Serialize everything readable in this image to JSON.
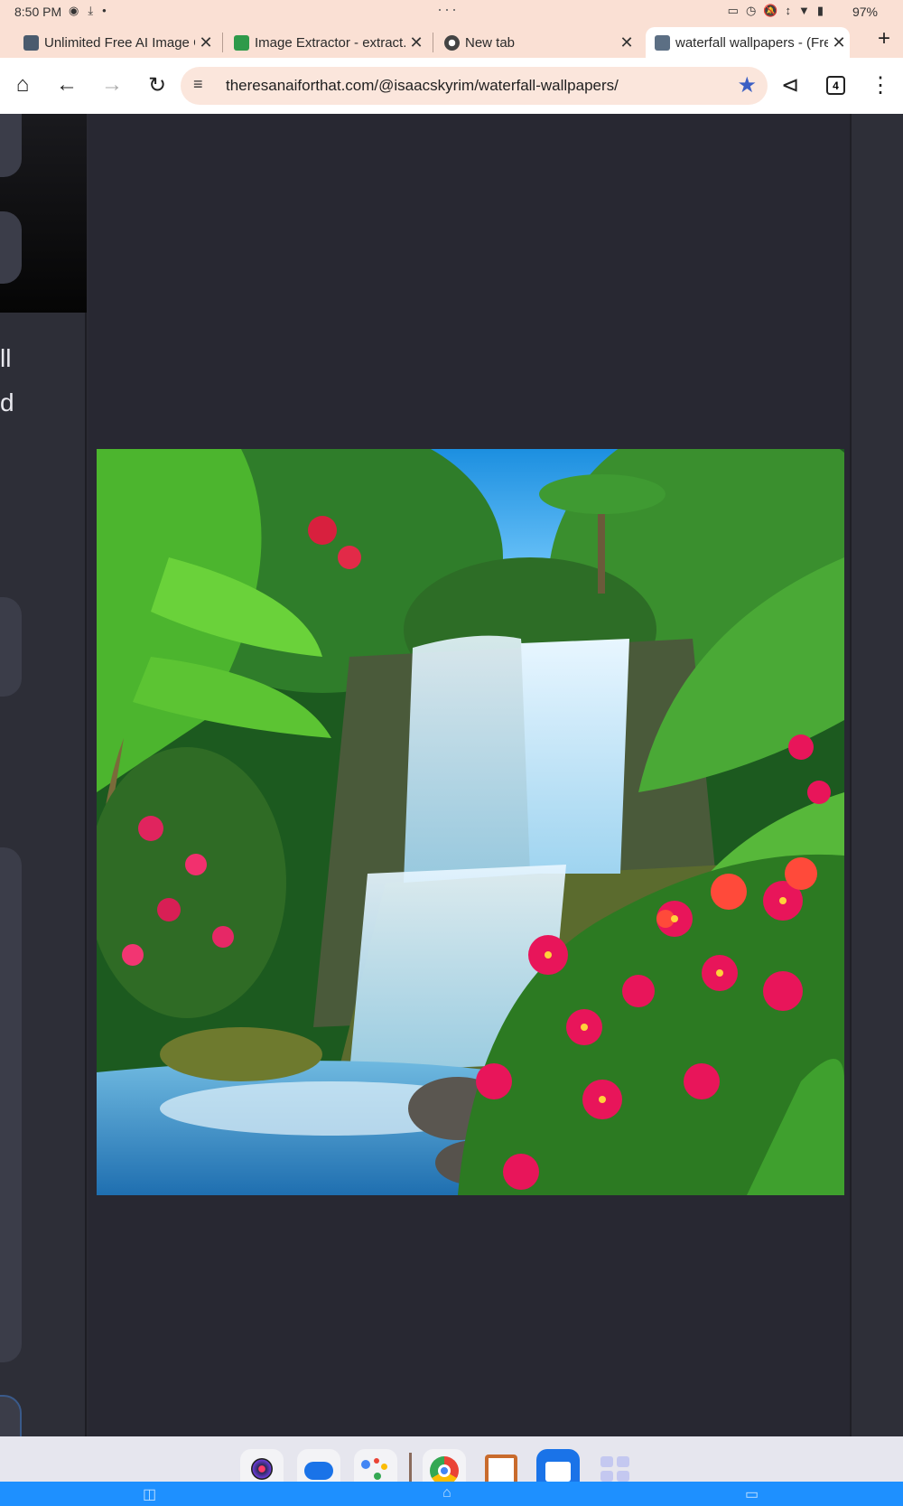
{
  "status_bar": {
    "time": "8:50 PM",
    "battery": "97%",
    "left_icons": [
      "camera-icon",
      "download-icon",
      "dot-icon"
    ],
    "right_icons": [
      "cast-icon",
      "alarm-icon",
      "mute-icon",
      "signal-icon",
      "wifi-icon",
      "battery-icon"
    ]
  },
  "tabs": [
    {
      "label": "Unlimited Free AI Image G",
      "favicon": "ai-image-favicon",
      "active": false
    },
    {
      "label": "Image Extractor - extract.p",
      "favicon": "extractor-favicon",
      "active": false
    },
    {
      "label": "New tab",
      "favicon": "chrome-favicon",
      "active": false
    },
    {
      "label": "waterfall wallpapers - (Fre",
      "favicon": "taaft-favicon",
      "active": true
    }
  ],
  "toolbar": {
    "url": "theresanaiforthat.com/@isaacskyrim/waterfall-wallpapers/",
    "tab_count": "4",
    "bookmark_color": "#3b5fc4"
  },
  "page": {
    "partial_text_lines": [
      "ll",
      "d"
    ],
    "image_alt": "waterfall wallpaper"
  },
  "dock": {
    "apps": [
      "camera-app-icon",
      "messages-app-icon",
      "assistant-app-icon",
      "chrome-app-icon",
      "clipboard-app-icon",
      "files-app-icon",
      "app-drawer-icon"
    ]
  },
  "colors": {
    "chrome_frame": "#fae0d4",
    "omnibox": "#fbe6dc",
    "page_background": "#282832",
    "nav_bar": "#1e90ff"
  }
}
